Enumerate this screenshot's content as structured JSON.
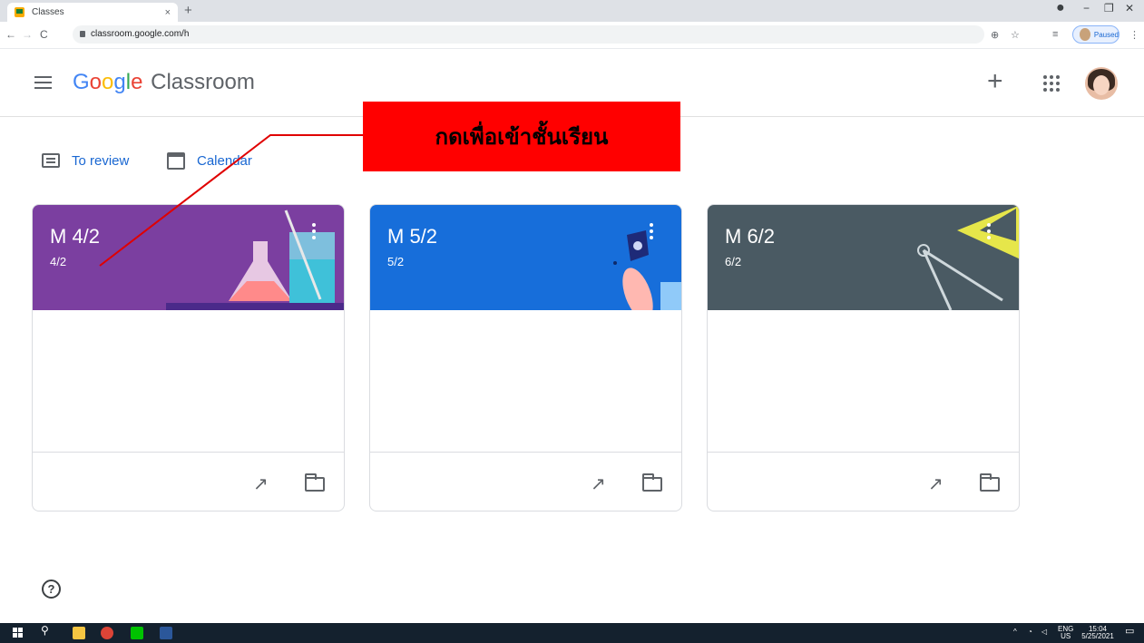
{
  "browser": {
    "tab_title": "Classes",
    "tab_close": "×",
    "new_tab": "+",
    "url": "classroom.google.com/h",
    "profile_status": "Paused",
    "controls": {
      "minimize": "−",
      "restore": "❐",
      "close": "✕"
    }
  },
  "header": {
    "logo_google": [
      "G",
      "o",
      "o",
      "g",
      "l",
      "e"
    ],
    "logo_product": "Classroom"
  },
  "subnav": {
    "to_review": "To review",
    "calendar": "Calendar"
  },
  "annotation": {
    "text": "กดเพื่อเข้าชั้นเรียน",
    "color": "#ff0000"
  },
  "classes": [
    {
      "name": "M 4/2",
      "section": "4/2",
      "color": "#7b3fa0"
    },
    {
      "name": "M 5/2",
      "section": "5/2",
      "color": "#1a73e8"
    },
    {
      "name": "M 6/2",
      "section": "6/2",
      "color": "#4a5a63"
    }
  ],
  "taskbar": {
    "lang": "ENG",
    "region": "US",
    "time": "15:04",
    "date": "5/25/2021"
  }
}
